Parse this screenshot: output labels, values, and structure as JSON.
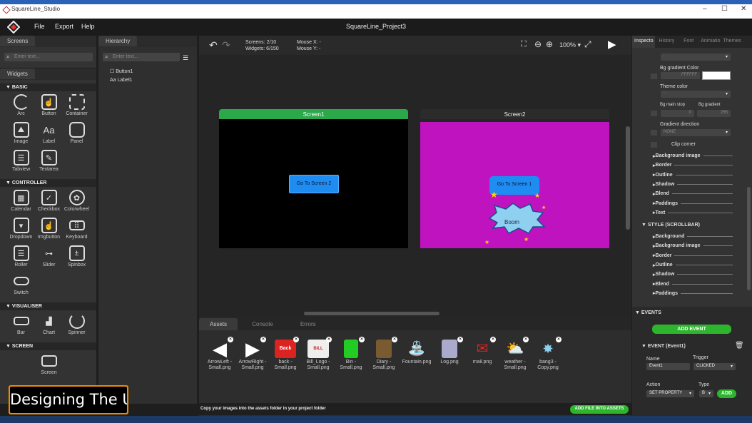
{
  "window": {
    "title": "SquareLine_Studio",
    "minimize": "–",
    "maximize": "☐",
    "close": "✕"
  },
  "menu": {
    "file": "File",
    "export": "Export",
    "help": "Help",
    "project": "SquareLine_Project3"
  },
  "screens_panel": {
    "tab": "Screens",
    "search": "Enter text..."
  },
  "widgets_panel": {
    "tab": "Widgets",
    "basic": {
      "title": "BASIC",
      "items": [
        "Arc",
        "Button",
        "Container",
        "Image",
        "Label",
        "Panel",
        "Tabview",
        "Textarea"
      ]
    },
    "controller": {
      "title": "CONTROLLER",
      "items": [
        "Calendar",
        "Checkbox",
        "Colorwheel",
        "Dropdown",
        "Imgbutton",
        "Keyboard",
        "Roller",
        "Slider",
        "Spinbox",
        "Switch"
      ]
    },
    "visualiser": {
      "title": "VISUALISER",
      "items": [
        "Bar",
        "Chart",
        "Spinner"
      ]
    },
    "screen": {
      "title": "SCREEN",
      "items": [
        "Screen"
      ]
    }
  },
  "hierarchy": {
    "tab": "Hierarchy",
    "search": "Enter text...",
    "items": [
      "Button1",
      "Label1"
    ]
  },
  "toolbar": {
    "screens": "Screens: 2/10",
    "widgets": "Widgets: 6/150",
    "mouse_x": "Mouse X: -",
    "mouse_y": "Mouse Y: -",
    "zoom": "100%"
  },
  "canvas": {
    "screen1": {
      "title": "Screen1",
      "button": "Go To Screen 2"
    },
    "screen2": {
      "title": "Screen2",
      "button": "Go To Screen 1",
      "label": "Boom"
    },
    "colors": {
      "active": "#2aa84a",
      "screen2_bg": "#c013c0",
      "button": "#1f8cf2"
    }
  },
  "bottom": {
    "tabs": [
      "Assets",
      "Console",
      "Errors"
    ],
    "assets": [
      "ArrowLeft - Small.png",
      "ArrowRight - Small.png",
      "back - Small.png",
      "Bill_Logo - Small.png",
      "Bin - Small.png",
      "Diary - Small.png",
      "Fountain.png",
      "Log.png",
      "mail.png",
      "weather - Small.png",
      "bang3 - Copy.png"
    ],
    "hint": "Copy your images into the assets folder in your project folder",
    "add_file": "ADD FILE INTO ASSETS"
  },
  "inspector": {
    "tabs": [
      "Inspecto",
      "History",
      "Font",
      "Animatio",
      "Themes"
    ],
    "dash": "-",
    "bg_gradient_color": "Bg gradient Color",
    "gradient_hex": "FFFFFF",
    "theme_color": "Theme color",
    "bg_main_stop": "Bg main stop",
    "bg_gradient": "Bg gradient",
    "main_stop_val": "0",
    "gradient_val": "255",
    "gradient_direction": "Gradient direction",
    "direction_val": "NONE",
    "clip_corner": "Clip corner",
    "subsections": [
      "Background image",
      "Border",
      "Outline",
      "Shadow",
      "Blend",
      "Paddings",
      "Text"
    ],
    "scrollbar_title": "STYLE (SCROLLBAR)",
    "scroll_subsections": [
      "Background",
      "Background image",
      "Border",
      "Outline",
      "Shadow",
      "Blend",
      "Paddings"
    ],
    "events_title": "EVENTS",
    "add_event": "ADD EVENT",
    "event_title": "EVENT (Event1)",
    "name_label": "Name",
    "trigger_label": "Trigger",
    "name_val": "Event1",
    "trigger_val": "CLICKED",
    "action_label": "Action",
    "type_label": "Type",
    "action_val": "SET PROPERTY",
    "type_val": "B",
    "add": "ADD"
  },
  "overlay": {
    "caption": "Designing The UI"
  }
}
